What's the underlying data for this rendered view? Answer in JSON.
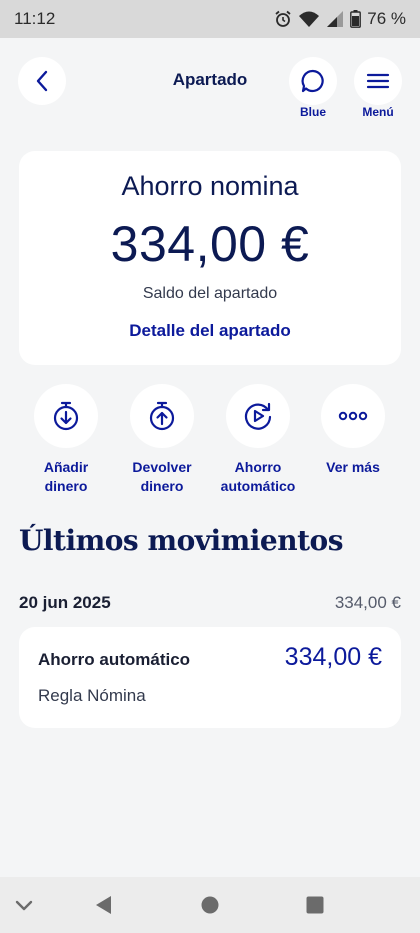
{
  "status_bar": {
    "time": "11:12",
    "battery": "76 %"
  },
  "header": {
    "title": "Apartado",
    "chat_label": "Blue",
    "menu_label": "Menú"
  },
  "balance": {
    "name": "Ahorro nomina",
    "amount": "334,00 €",
    "label": "Saldo del apartado",
    "detail_link": "Detalle del apartado"
  },
  "actions": [
    {
      "label_line1": "Añadir",
      "label_line2": "dinero",
      "icon": "stopwatch-down-icon"
    },
    {
      "label_line1": "Devolver",
      "label_line2": "dinero",
      "icon": "stopwatch-up-icon"
    },
    {
      "label_line1": "Ahorro",
      "label_line2": "automático",
      "icon": "auto-play-icon"
    },
    {
      "label_line1": "Ver más",
      "label_line2": "",
      "icon": "more-dots-icon"
    }
  ],
  "movements": {
    "title": "Últimos movimientos",
    "groups": [
      {
        "date": "20 jun 2025",
        "total": "334,00 €",
        "items": [
          {
            "title": "Ahorro automático",
            "amount": "334,00 €",
            "subtitle": "Regla Nómina"
          }
        ]
      }
    ]
  },
  "colors": {
    "accent": "#0c1a9b",
    "navy": "#0c1a53",
    "background": "#f4f5f6"
  }
}
